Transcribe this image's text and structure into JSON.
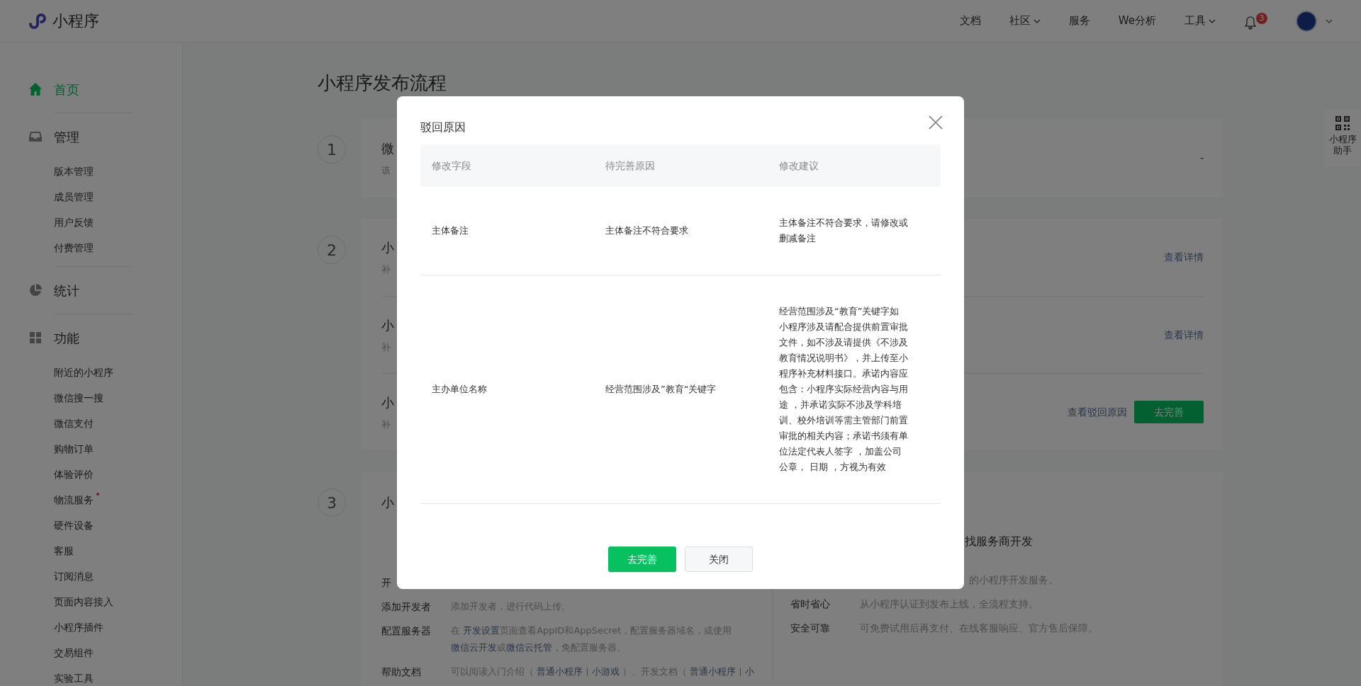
{
  "header": {
    "logo_text": "小程序",
    "nav": [
      {
        "label": "文档",
        "dropdown": false
      },
      {
        "label": "社区",
        "dropdown": true
      },
      {
        "label": "服务",
        "dropdown": false
      },
      {
        "label": "We分析",
        "dropdown": false
      },
      {
        "label": "工具",
        "dropdown": true
      }
    ],
    "notification_count": "3"
  },
  "sidebar": {
    "groups": [
      {
        "label": "首页",
        "selected": true
      },
      {
        "label": "管理",
        "selected": false,
        "items": [
          {
            "label": "版本管理",
            "dot": false
          },
          {
            "label": "成员管理",
            "dot": false
          },
          {
            "label": "用户反馈",
            "dot": false
          },
          {
            "label": "付费管理",
            "dot": false
          }
        ]
      },
      {
        "label": "统计",
        "selected": false
      },
      {
        "label": "功能",
        "selected": false,
        "items": [
          {
            "label": "附近的小程序",
            "dot": false
          },
          {
            "label": "微信搜一搜",
            "dot": false
          },
          {
            "label": "微信支付",
            "dot": false
          },
          {
            "label": "购物订单",
            "dot": false
          },
          {
            "label": "体验评价",
            "dot": false
          },
          {
            "label": "物流服务",
            "dot": true
          },
          {
            "label": "硬件设备",
            "dot": false
          },
          {
            "label": "客服",
            "dot": false
          },
          {
            "label": "订阅消息",
            "dot": false
          },
          {
            "label": "页面内容接入",
            "dot": false
          },
          {
            "label": "小程序插件",
            "dot": false
          },
          {
            "label": "交易组件",
            "dot": false
          },
          {
            "label": "实验工具",
            "dot": false
          }
        ]
      }
    ]
  },
  "page_title": "小程序发布流程",
  "steps": [
    {
      "number": "1",
      "rows": [
        {
          "title": "微",
          "subtitle": "该",
          "actions": [
            {
              "kind": "text",
              "label": "-"
            }
          ]
        }
      ]
    },
    {
      "number": "2",
      "rows": [
        {
          "title": "小",
          "subtitle": "补",
          "actions": [
            {
              "kind": "link",
              "label": "查看详情"
            }
          ]
        },
        {
          "title": "小",
          "subtitle": "补",
          "actions": [
            {
              "kind": "link",
              "label": "查看详情"
            }
          ]
        },
        {
          "title": "小",
          "subtitle": "补",
          "actions": [
            {
              "kind": "link",
              "label": "查看驳回原因"
            },
            {
              "kind": "button",
              "label": "去完善"
            }
          ]
        }
      ]
    }
  ],
  "step3": {
    "number": "3",
    "title": "小",
    "left_rows": [
      {
        "label": "开"
      },
      {
        "label": "添加开发者",
        "desc": [
          {
            "text": "添加开发者，进行代码上传。",
            "kind": "text"
          }
        ]
      },
      {
        "label": "配置服务器",
        "desc": [
          {
            "text": "在 ",
            "kind": "text"
          },
          {
            "text": "开发设置",
            "kind": "link"
          },
          {
            "text": "页面查看AppID和AppSecret，配置服务器域名，或使用",
            "kind": "text"
          },
          {
            "text": "微信云开发",
            "kind": "link"
          },
          {
            "text": "或",
            "kind": "text"
          },
          {
            "text": "微信云托管",
            "kind": "link"
          },
          {
            "text": "，免配置服务器。",
            "kind": "text"
          }
        ]
      },
      {
        "label": "帮助文档",
        "desc": [
          {
            "text": "可以阅读入门介绍（ ",
            "kind": "text"
          },
          {
            "text": "普通小程序",
            "kind": "link"
          },
          {
            "text": " | ",
            "kind": "text"
          },
          {
            "text": "小游戏",
            "kind": "link"
          },
          {
            "text": " ）、开发文档（ ",
            "kind": "text"
          },
          {
            "text": "普通小程序",
            "kind": "link"
          },
          {
            "text": " | ",
            "kind": "text"
          },
          {
            "text": "小",
            "kind": "link"
          }
        ]
      }
    ],
    "right_title": "找服务商开发",
    "right_rows": [
      {
        "desc": "的小程序开发服务。"
      },
      {
        "label": "省时省心",
        "desc": "从小程序认证到发布上线，全流程支持。"
      },
      {
        "label": "安全可靠",
        "desc": "可免费试用后再支付、在线客服响应、官方售后保障。"
      }
    ]
  },
  "helper": {
    "label": "小程序助手"
  },
  "dialog": {
    "title": "驳回原因",
    "columns": [
      "修改字段",
      "待完善原因",
      "修改建议"
    ],
    "rows": [
      [
        "主体备注",
        "主体备注不符合要求",
        "主体备注不符合要求，请修改或删减备注"
      ],
      [
        "主办单位名称",
        "经营范围涉及”教育“关键字",
        "经营范围涉及“教育”关键字如小程序涉及请配合提供前置审批文件，如不涉及请提供《不涉及教育情况说明书》，并上传至小程序补充材料接口。承诺内容应包含：小程序实际经营内容与用途 ，并承诺实际不涉及学科培训、校外培训等需主管部门前置审批的相关内容；承诺书须有单位法定代表人签字 ，加盖公司公章， 日期 ，方视为有效"
      ]
    ],
    "buttons": [
      {
        "kind": "primary",
        "label": "去完善"
      },
      {
        "kind": "default",
        "label": "关闭"
      }
    ]
  }
}
